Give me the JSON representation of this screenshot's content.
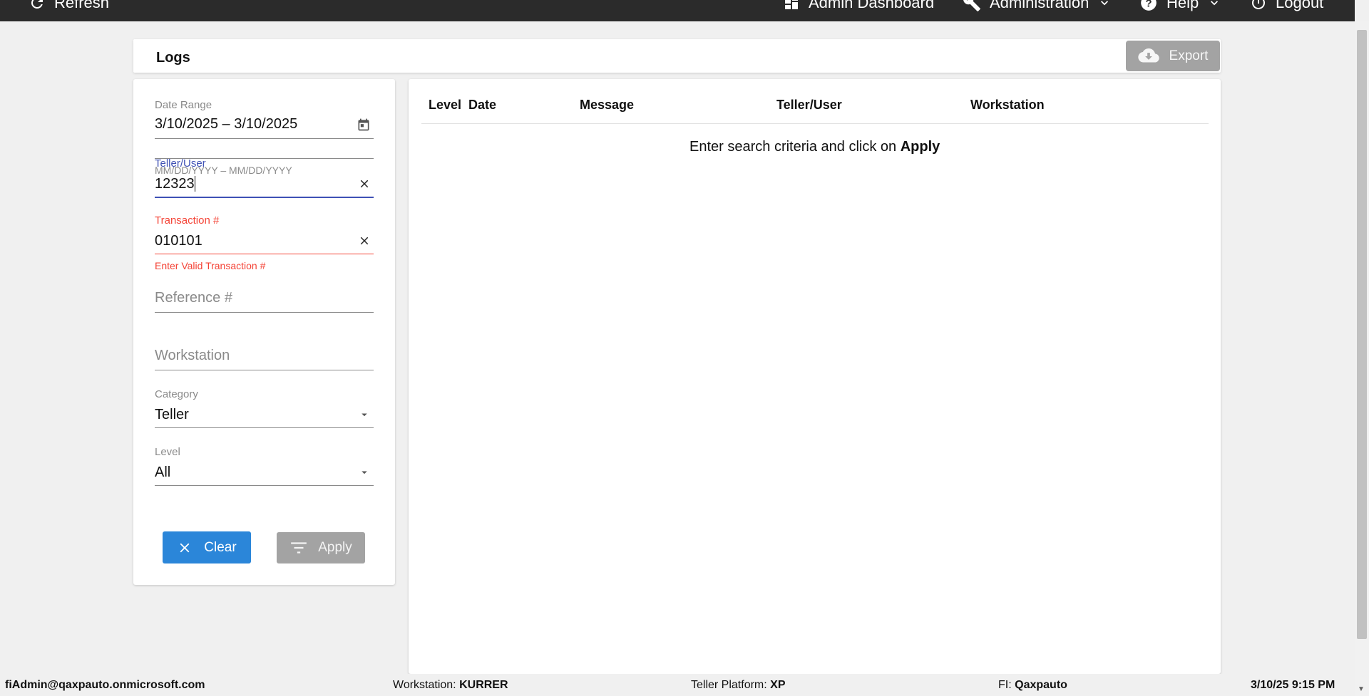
{
  "topbar": {
    "refresh": "Refresh",
    "admin_dashboard": "Admin Dashboard",
    "administration": "Administration",
    "help": "Help",
    "logout": "Logout"
  },
  "page": {
    "title": "Logs",
    "export_label": "Export"
  },
  "filters": {
    "date_range": {
      "label": "Date Range",
      "value": "3/10/2025 – 3/10/2025",
      "hint": "MM/DD/YYYY – MM/DD/YYYY"
    },
    "teller_user": {
      "label": "Teller/User",
      "value": "12323"
    },
    "transaction": {
      "label": "Transaction #",
      "value": "010101",
      "error": "Enter Valid Transaction #"
    },
    "reference": {
      "placeholder": "Reference #"
    },
    "workstation": {
      "placeholder": "Workstation"
    },
    "category": {
      "label": "Category",
      "value": "Teller"
    },
    "level": {
      "label": "Level",
      "value": "All"
    },
    "clear_label": "Clear",
    "apply_label": "Apply"
  },
  "results": {
    "columns": [
      "Level",
      "Date",
      "Message",
      "Teller/User",
      "Workstation"
    ],
    "empty_prefix": "Enter search criteria and click on ",
    "empty_action": "Apply"
  },
  "footer": {
    "user": "fiAdmin@qaxpauto.onmicrosoft.com",
    "workstation_label": "Workstation:",
    "workstation_value": "KURRER",
    "platform_label": "Teller Platform:",
    "platform_value": "XP",
    "fi_label": "FI:",
    "fi_value": "Qaxpauto",
    "datetime": "3/10/25 9:15 PM"
  },
  "colors": {
    "accent_blue": "#2b86d9",
    "focus_indigo": "#3f51b5",
    "error_red": "#f44336",
    "disabled_gray": "#a3a3a3",
    "topbar_bg": "#2b2b2b"
  }
}
